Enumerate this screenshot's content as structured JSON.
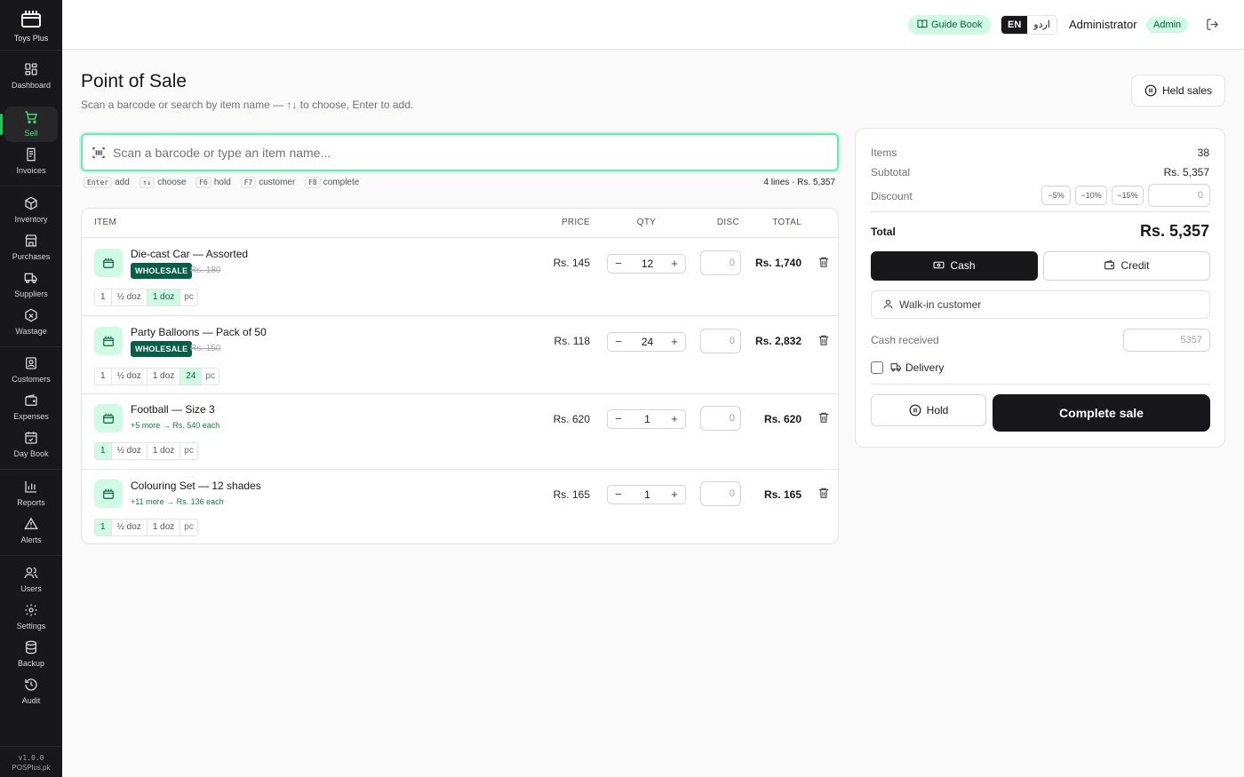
{
  "app": {
    "name": "Toys Plus",
    "version": "v1.0.0",
    "vendor": "POSPlus.pk"
  },
  "sidebar": {
    "items": [
      {
        "label": "Dashboard",
        "icon": "dashboard-icon"
      },
      {
        "label": "Sell",
        "icon": "cart-icon",
        "active": true
      },
      {
        "label": "Invoices",
        "icon": "invoice-icon"
      },
      {
        "label": "Inventory",
        "icon": "box-icon"
      },
      {
        "label": "Purchases",
        "icon": "store-icon"
      },
      {
        "label": "Suppliers",
        "icon": "truck-icon"
      },
      {
        "label": "Wastage",
        "icon": "box-x-icon"
      },
      {
        "label": "Customers",
        "icon": "contact-icon"
      },
      {
        "label": "Expenses",
        "icon": "wallet-icon"
      },
      {
        "label": "Day Book",
        "icon": "calendar-check-icon"
      },
      {
        "label": "Reports",
        "icon": "bar-chart-icon"
      },
      {
        "label": "Alerts",
        "icon": "alert-triangle-icon"
      },
      {
        "label": "Users",
        "icon": "users-icon"
      },
      {
        "label": "Settings",
        "icon": "gear-icon"
      },
      {
        "label": "Backup",
        "icon": "database-icon"
      },
      {
        "label": "Audit",
        "icon": "history-icon"
      }
    ]
  },
  "header": {
    "guide_label": "Guide Book",
    "lang_en": "EN",
    "lang_ur": "اردو",
    "user_name": "Administrator",
    "role": "Admin"
  },
  "page": {
    "title": "Point of Sale",
    "subtitle": "Scan a barcode or search by item name — ↑↓ to choose, Enter to add.",
    "held_label": "Held sales"
  },
  "search": {
    "placeholder": "Scan a barcode or type an item name...",
    "hints": [
      {
        "key": "Enter",
        "label": "add"
      },
      {
        "key": "↑↓",
        "label": "choose"
      },
      {
        "key": "F6",
        "label": "hold"
      },
      {
        "key": "F7",
        "label": "customer"
      },
      {
        "key": "F8",
        "label": "complete"
      }
    ],
    "summary": "4 lines · Rs. 5,357"
  },
  "cart": {
    "headers": {
      "item": "ITEM",
      "price": "PRICE",
      "qty": "QTY",
      "disc": "DISC",
      "total": "TOTAL"
    },
    "unit_options": [
      "1",
      "½ doz",
      "1 doz",
      "pc"
    ],
    "rows": [
      {
        "name": "Die-cast Car — Assorted",
        "badge": "WHOLESALE",
        "old_price": "Rs. 180",
        "price": "Rs. 145",
        "qty": "12",
        "disc": "0",
        "total": "Rs. 1,740",
        "selected_unit": "1 doz",
        "units": [
          "1",
          "½ doz",
          "1 doz",
          "pc"
        ]
      },
      {
        "name": "Party Balloons — Pack of 50",
        "badge": "WHOLESALE",
        "old_price": "Rs. 150",
        "price": "Rs. 118",
        "qty": "24",
        "disc": "0",
        "total": "Rs. 2,832",
        "selected_unit": "24",
        "units": [
          "1",
          "½ doz",
          "1 doz",
          "24",
          "pc"
        ]
      },
      {
        "name": "Football — Size 3",
        "deal": "+5 more → Rs. 540 each",
        "price": "Rs. 620",
        "qty": "1",
        "disc": "0",
        "total": "Rs. 620",
        "selected_unit": "1",
        "units": [
          "1",
          "½ doz",
          "1 doz",
          "pc"
        ]
      },
      {
        "name": "Colouring Set — 12 shades",
        "deal": "+11 more → Rs. 136 each",
        "price": "Rs. 165",
        "qty": "1",
        "disc": "0",
        "total": "Rs. 165",
        "selected_unit": "1",
        "units": [
          "1",
          "½ doz",
          "1 doz",
          "pc"
        ]
      }
    ]
  },
  "summary": {
    "items_label": "Items",
    "items_value": "38",
    "subtotal_label": "Subtotal",
    "subtotal_value": "Rs. 5,357",
    "discount_label": "Discount",
    "discount_chips": [
      "−5%",
      "−10%",
      "−15%"
    ],
    "discount_placeholder": "0",
    "total_label": "Total",
    "total_value": "Rs. 5,357",
    "cash_label": "Cash",
    "credit_label": "Credit",
    "customer": "Walk-in customer",
    "cash_received_label": "Cash received",
    "cash_received_placeholder": "5357",
    "delivery_label": "Delivery",
    "hold_label": "Hold",
    "complete_label": "Complete sale"
  },
  "colors": {
    "accent": "#065f46",
    "accent_light": "#d1fae5",
    "sidebar_bg": "#18181b",
    "active_green": "#22c55e"
  }
}
